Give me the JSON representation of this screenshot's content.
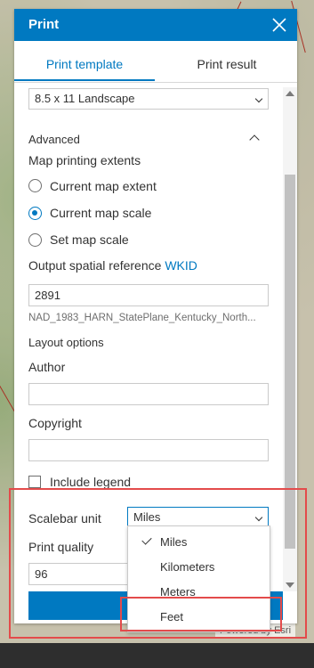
{
  "panel": {
    "title": "Print",
    "tabs": [
      "Print template",
      "Print result"
    ]
  },
  "template": {
    "layout_value": "8.5 x 11 Landscape"
  },
  "advanced": {
    "label": "Advanced",
    "extents_label": "Map printing extents",
    "extent_options": [
      "Current map extent",
      "Current map scale",
      "Set map scale"
    ],
    "extent_selected": "Current map scale",
    "spatial_ref_label": "Output spatial reference",
    "wkid_link": "WKID",
    "wkid_value": "2891",
    "wkid_description": "NAD_1983_HARN_StatePlane_Kentucky_North...",
    "layout_options_label": "Layout options",
    "author_label": "Author",
    "author_value": "",
    "copyright_label": "Copyright",
    "copyright_value": "",
    "include_legend_label": "Include legend",
    "scalebar_label": "Scalebar unit",
    "scalebar_value": "Miles",
    "print_quality_label": "Print quality",
    "print_quality_value": "96"
  },
  "scalebar_dropdown": {
    "options": [
      "Miles",
      "Kilometers",
      "Meters",
      "Feet"
    ],
    "selected": "Miles"
  },
  "map": {
    "attribution": "Powered by Esri"
  },
  "colors": {
    "accent": "#0079c1",
    "highlight": "#e34b4b"
  }
}
